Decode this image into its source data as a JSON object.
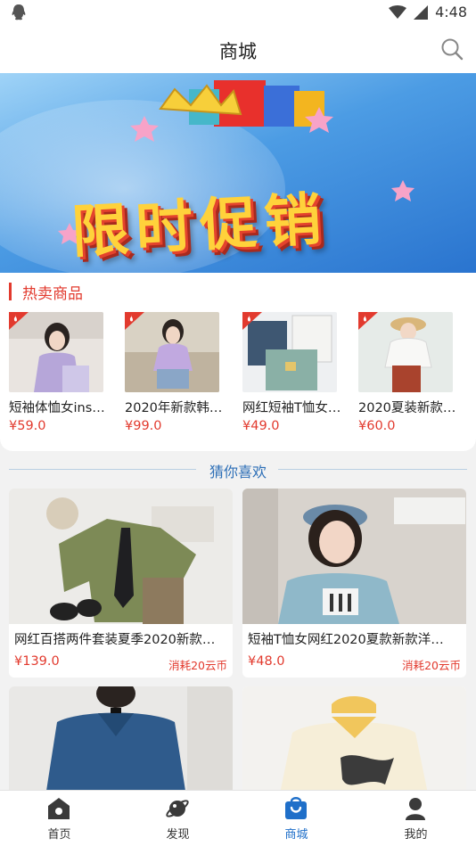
{
  "status_bar": {
    "time": "4:48",
    "icons": [
      "qq-icon",
      "wifi-icon",
      "signal-icon"
    ]
  },
  "header": {
    "title": "商城",
    "search_icon": "search-icon"
  },
  "banner": {
    "promo_text": "限时促销",
    "slide_count": 1,
    "active_slide": 1
  },
  "hot_section": {
    "title": "热卖商品",
    "items": [
      {
        "name": "短袖体恤女ins…",
        "price": "¥59.0"
      },
      {
        "name": "2020年新款韩…",
        "price": "¥99.0"
      },
      {
        "name": "网红短袖T恤女…",
        "price": "¥49.0"
      },
      {
        "name": "2020夏装新款…",
        "price": "¥60.0"
      }
    ]
  },
  "guess_section": {
    "title": "猜你喜欢",
    "cards": [
      {
        "name": "网红百搭两件套装夏季2020新款…",
        "price": "¥139.0",
        "cost": "消耗20云币"
      },
      {
        "name": "短袖T恤女网红2020夏款新款洋…",
        "price": "¥48.0",
        "cost": "消耗20云币"
      },
      {
        "name": "",
        "price": "",
        "cost": ""
      },
      {
        "name": "",
        "price": "",
        "cost": ""
      }
    ]
  },
  "tab_bar": {
    "tabs": [
      {
        "label": "首页",
        "icon": "home-icon"
      },
      {
        "label": "发现",
        "icon": "planet-icon"
      },
      {
        "label": "商城",
        "icon": "shop-bag-icon",
        "active": true
      },
      {
        "label": "我的",
        "icon": "user-icon"
      }
    ]
  },
  "colors": {
    "accent_red": "#e23a2e",
    "accent_blue": "#1f6fc9",
    "banner_blue": "#4c9ce4"
  }
}
